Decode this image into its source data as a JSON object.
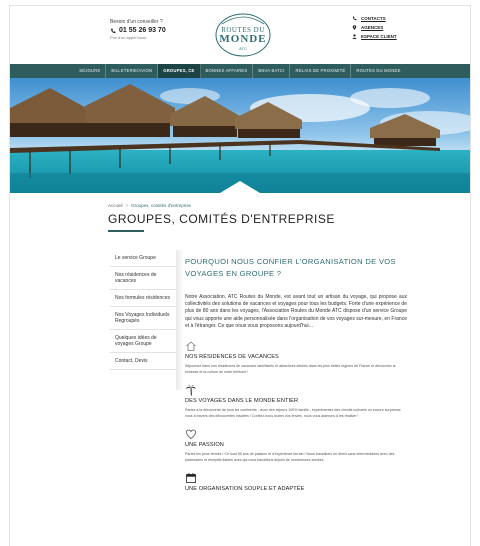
{
  "header": {
    "advisor_label": "Besoin d'un conseiller ?",
    "phone": "01 55 26 93 70",
    "phone_note": "Prix d'un appel local",
    "logo_line1": "ROUTES DU",
    "logo_line2": "MONDE",
    "logo_line3": "ATC",
    "links": [
      {
        "label": "CONTACTS",
        "icon": "phone-icon"
      },
      {
        "label": "AGENCES",
        "icon": "map-pin-icon"
      },
      {
        "label": "ESPACE CLIENT",
        "icon": "user-icon"
      }
    ]
  },
  "nav": {
    "items": [
      "SÉJOURS",
      "BILLETERIE/AVION",
      "GROUPES, CE",
      "BONNES AFFAIRES",
      "BNVA BATCI",
      "RELAIS DE PROXIMITÉ",
      "ROUTES DU MONDE"
    ],
    "active_index": 2
  },
  "breadcrumb": {
    "home": "Accueil",
    "separator": ">",
    "current": "Groupes, comités d'entreprise"
  },
  "page_title": "GROUPES, COMITÉS D'ENTREPRISE",
  "sidebar": {
    "items": [
      "Le service Groupe",
      "Nos résidences de vacances",
      "Nos formules résidences",
      "Nos Voyages Individuels Regroupés",
      "Quelques idées de voyages Groupe",
      "Contact, Devis"
    ]
  },
  "main": {
    "heading": "Pourquoi nous confier l'organisation de vos voyages en groupe ?",
    "intro": "Notre Association, ATC Routes du Monde, est avant tout un artisan du voyage, qui propose aux collectivités des solutions de vacances et voyages pour tous les budgets. Forte d'une expérience de plus de 80 ans dans les voyages, l'Association Routes du Monde ATC dispose d'un service Groupe qui vous apporte une aide personnalisée dans l'organisation de vos voyages sur-mesure, en France et à l'étranger. Ce que nous vous proposons aujourd'hui...",
    "features": [
      {
        "icon": "house-icon",
        "title": "Nos résidences de vacances",
        "text": "Séjournez dans nos résidences de vacances labellisées et attractives situées dans les plus belles régions de France et découvrez la richesse et la culture de notre territoire !"
      },
      {
        "icon": "palm-tree-icon",
        "title": "Des voyages dans le monde entier",
        "text": "Partez à la découverte de tous les continents : vivez des séjours 100% famille ; expérimentez des circuits culturels ou encore surprenez vous à travers des découvertes insolites ! Confiez-nous toutes vos envies, nous vous aiderons à les réaliser !"
      },
      {
        "icon": "heart-icon",
        "title": "Une passion",
        "text": "Partez les yeux fermés ! Ce sont 80 ans de passion et d'expérience terrain ! Nous travaillons en direct sans intermédiaires avec des partenaires et réceptifs fiables avec qui nous travaillons depuis de nombreuses années."
      },
      {
        "icon": "calendar-icon",
        "title": "Une organisation souple et adaptée",
        "text": ""
      }
    ]
  },
  "colors": {
    "brand_teal": "#2f6e73",
    "nav_bg": "#2f5d5d",
    "nav_active": "#1d4444"
  }
}
